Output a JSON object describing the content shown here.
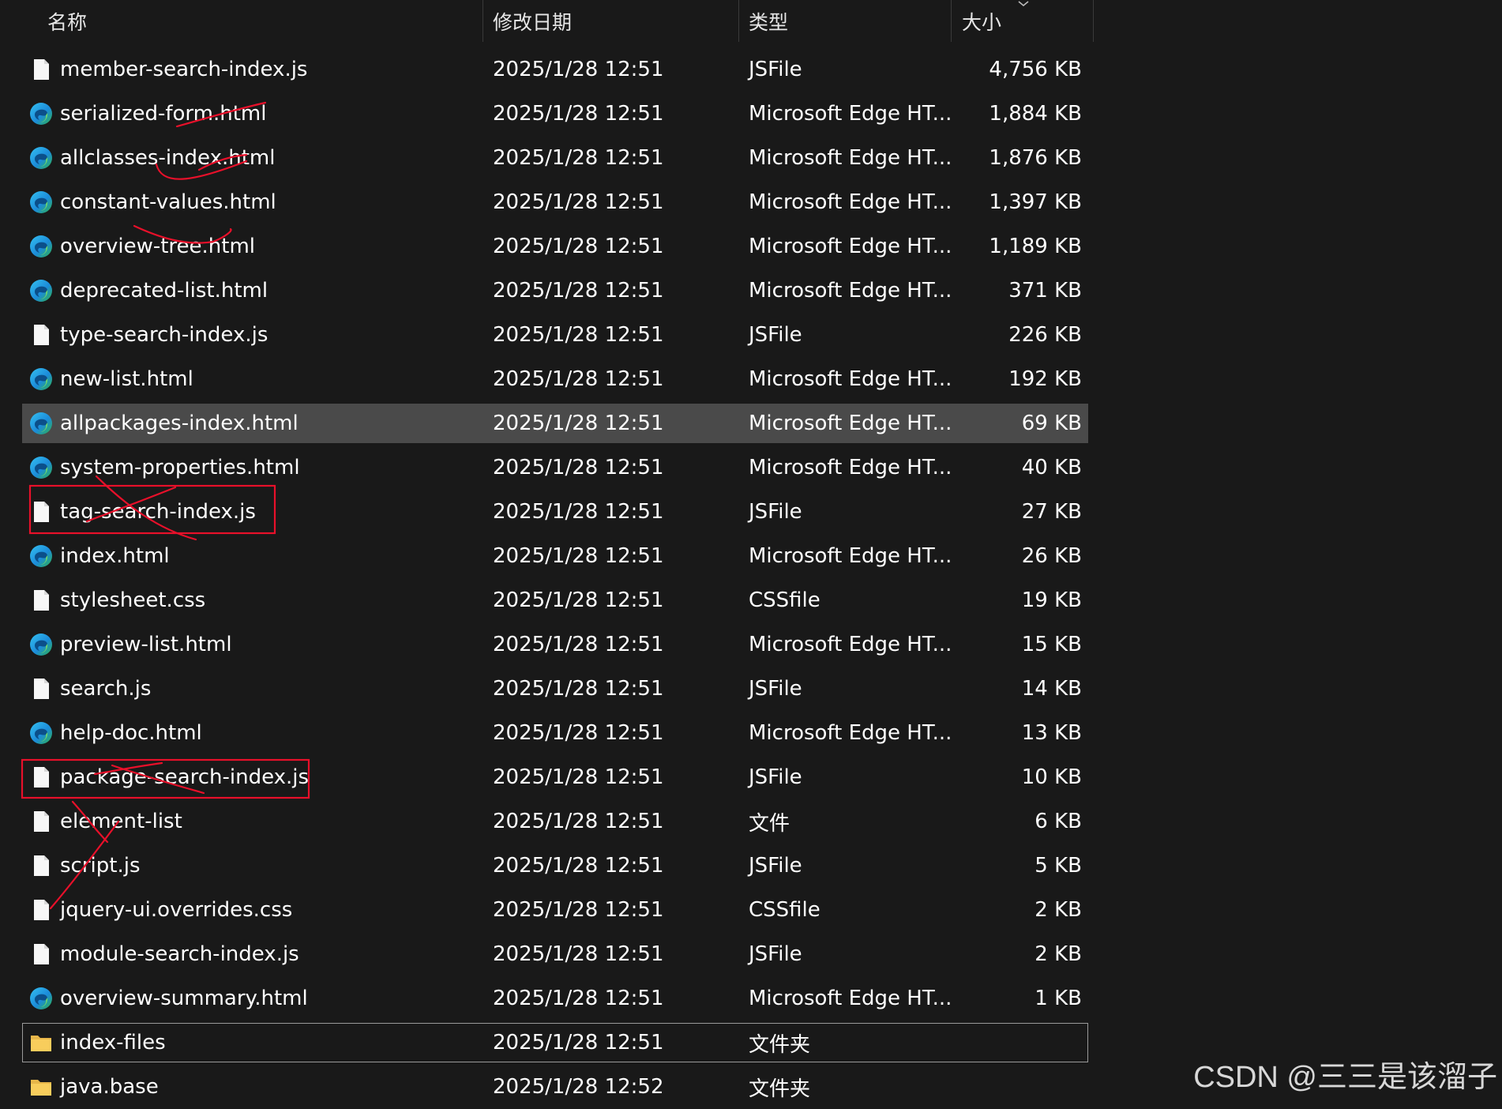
{
  "header": {
    "name": "名称",
    "date": "修改日期",
    "type": "类型",
    "size": "大小"
  },
  "files": [
    {
      "name": "member-search-index.js",
      "date": "2025/1/28 12:51",
      "type": "JSFile",
      "size": "4,756 KB",
      "icon": "file-icon"
    },
    {
      "name": "serialized-form.html",
      "date": "2025/1/28 12:51",
      "type": "Microsoft Edge HT...",
      "size": "1,884 KB",
      "icon": "edge-icon"
    },
    {
      "name": "allclasses-index.html",
      "date": "2025/1/28 12:51",
      "type": "Microsoft Edge HT...",
      "size": "1,876 KB",
      "icon": "edge-icon"
    },
    {
      "name": "constant-values.html",
      "date": "2025/1/28 12:51",
      "type": "Microsoft Edge HT...",
      "size": "1,397 KB",
      "icon": "edge-icon"
    },
    {
      "name": "overview-tree.html",
      "date": "2025/1/28 12:51",
      "type": "Microsoft Edge HT...",
      "size": "1,189 KB",
      "icon": "edge-icon"
    },
    {
      "name": "deprecated-list.html",
      "date": "2025/1/28 12:51",
      "type": "Microsoft Edge HT...",
      "size": "371 KB",
      "icon": "edge-icon"
    },
    {
      "name": "type-search-index.js",
      "date": "2025/1/28 12:51",
      "type": "JSFile",
      "size": "226 KB",
      "icon": "file-icon"
    },
    {
      "name": "new-list.html",
      "date": "2025/1/28 12:51",
      "type": "Microsoft Edge HT...",
      "size": "192 KB",
      "icon": "edge-icon"
    },
    {
      "name": "allpackages-index.html",
      "date": "2025/1/28 12:51",
      "type": "Microsoft Edge HT...",
      "size": "69 KB",
      "icon": "edge-icon",
      "selected": true
    },
    {
      "name": "system-properties.html",
      "date": "2025/1/28 12:51",
      "type": "Microsoft Edge HT...",
      "size": "40 KB",
      "icon": "edge-icon"
    },
    {
      "name": "tag-search-index.js",
      "date": "2025/1/28 12:51",
      "type": "JSFile",
      "size": "27 KB",
      "icon": "file-icon"
    },
    {
      "name": "index.html",
      "date": "2025/1/28 12:51",
      "type": "Microsoft Edge HT...",
      "size": "26 KB",
      "icon": "edge-icon"
    },
    {
      "name": "stylesheet.css",
      "date": "2025/1/28 12:51",
      "type": "CSSfile",
      "size": "19 KB",
      "icon": "file-icon"
    },
    {
      "name": "preview-list.html",
      "date": "2025/1/28 12:51",
      "type": "Microsoft Edge HT...",
      "size": "15 KB",
      "icon": "edge-icon"
    },
    {
      "name": "search.js",
      "date": "2025/1/28 12:51",
      "type": "JSFile",
      "size": "14 KB",
      "icon": "file-icon"
    },
    {
      "name": "help-doc.html",
      "date": "2025/1/28 12:51",
      "type": "Microsoft Edge HT...",
      "size": "13 KB",
      "icon": "edge-icon"
    },
    {
      "name": "package-search-index.js",
      "date": "2025/1/28 12:51",
      "type": "JSFile",
      "size": "10 KB",
      "icon": "file-icon"
    },
    {
      "name": "element-list",
      "date": "2025/1/28 12:51",
      "type": "文件",
      "size": "6 KB",
      "icon": "file-icon"
    },
    {
      "name": "script.js",
      "date": "2025/1/28 12:51",
      "type": "JSFile",
      "size": "5 KB",
      "icon": "file-icon"
    },
    {
      "name": "jquery-ui.overrides.css",
      "date": "2025/1/28 12:51",
      "type": "CSSfile",
      "size": "2 KB",
      "icon": "file-icon"
    },
    {
      "name": "module-search-index.js",
      "date": "2025/1/28 12:51",
      "type": "JSFile",
      "size": "2 KB",
      "icon": "file-icon"
    },
    {
      "name": "overview-summary.html",
      "date": "2025/1/28 12:51",
      "type": "Microsoft Edge HT...",
      "size": "1 KB",
      "icon": "edge-icon"
    },
    {
      "name": "index-files",
      "date": "2025/1/28 12:51",
      "type": "文件夹",
      "size": "",
      "icon": "folder-icon",
      "focused": true
    },
    {
      "name": "java.base",
      "date": "2025/1/28 12:52",
      "type": "文件夹",
      "size": "",
      "icon": "folder-icon"
    }
  ],
  "watermark": "CSDN @三三是该溜子",
  "colors": {
    "background": "#191919",
    "selected_row": "#4a4a4a",
    "annotation": "#e8102a"
  }
}
